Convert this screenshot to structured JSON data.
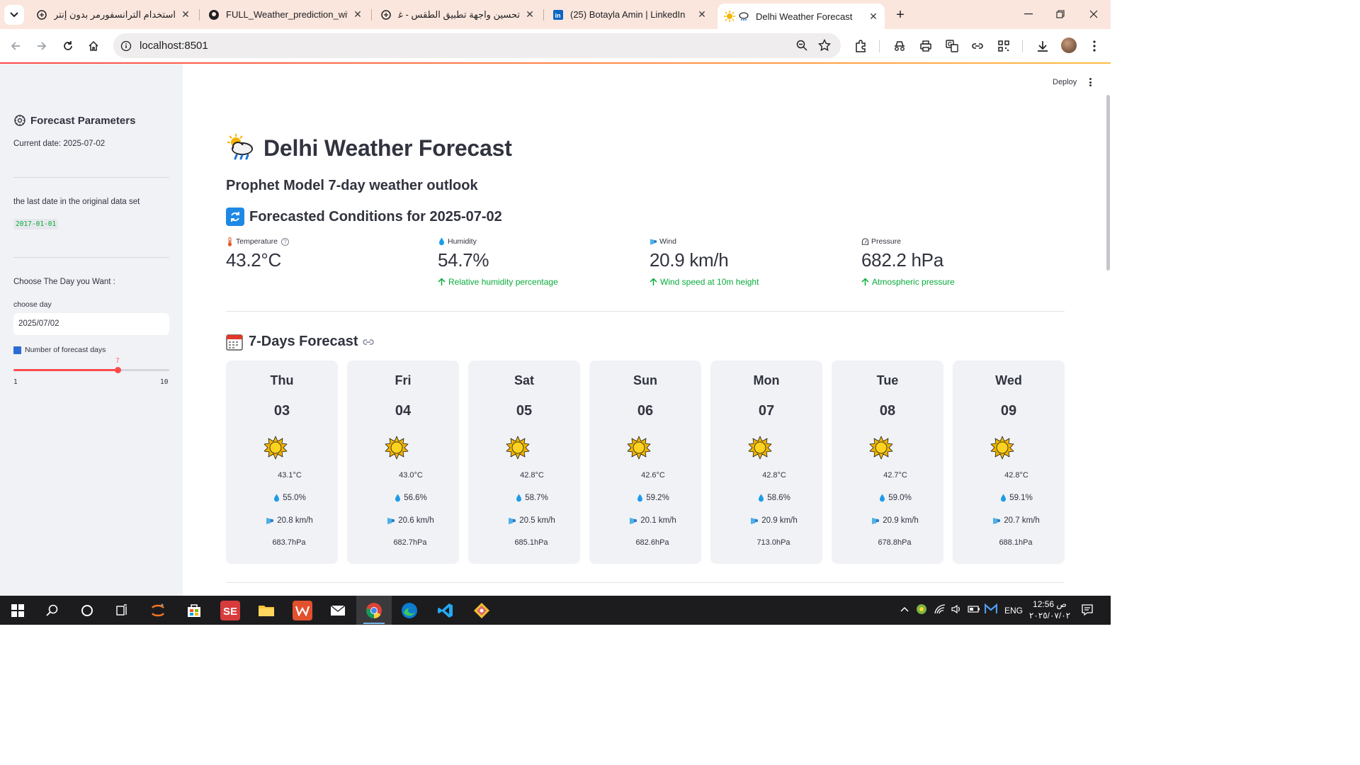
{
  "browser": {
    "tabs": [
      {
        "title": "استخدام الترانسفورمر بدون إنترنت",
        "icon": "openai-icon"
      },
      {
        "title": "FULL_Weather_prediction_with_",
        "icon": "github-icon"
      },
      {
        "title": "تحسين واجهة تطبيق الطقس - غر",
        "icon": "openai-icon"
      },
      {
        "title": "(25) Botayla Amin | LinkedIn",
        "icon": "linkedin-icon"
      },
      {
        "title": "Delhi Weather Forecast",
        "icon": "weather-icon",
        "active": true
      }
    ],
    "url": "localhost:8501"
  },
  "app": {
    "deploy_label": "Deploy",
    "title": "Delhi Weather Forecast",
    "subtitle": "Prophet Model 7-day weather outlook",
    "conditions_header": "Forecasted Conditions for 2025-07-02",
    "forecast_header": "7-Days Forecast"
  },
  "sidebar": {
    "header": "Forecast Parameters",
    "current_date": "Current date: 2025-07-02",
    "last_date_label": "the last date in the original data set",
    "last_date_value": "2017-01-01",
    "choose_prompt": "Choose The Day you Want :",
    "date_input_label": "choose day",
    "date_input_value": "2025/07/02",
    "slider_label": "Number of forecast days",
    "slider_value": 7,
    "slider_min": 1,
    "slider_max": 10
  },
  "metrics": [
    {
      "label": "Temperature",
      "value": "43.2°C",
      "delta": "",
      "icon": "thermometer-icon",
      "help": true
    },
    {
      "label": "Humidity",
      "value": "54.7%",
      "delta": "Relative humidity percentage",
      "icon": "droplet-icon"
    },
    {
      "label": "Wind",
      "value": "20.9 km/h",
      "delta": "Wind speed at 10m height",
      "icon": "wind-icon"
    },
    {
      "label": "Pressure",
      "value": "682.2 hPa",
      "delta": "Atmospheric pressure",
      "icon": "gauge-icon"
    }
  ],
  "forecast": [
    {
      "day": "Thu",
      "date": "03",
      "temp": "43.1°C",
      "humidity": "55.0%",
      "wind": "20.8 km/h",
      "pressure": "683.7hPa"
    },
    {
      "day": "Fri",
      "date": "04",
      "temp": "43.0°C",
      "humidity": "56.6%",
      "wind": "20.6 km/h",
      "pressure": "682.7hPa"
    },
    {
      "day": "Sat",
      "date": "05",
      "temp": "42.8°C",
      "humidity": "58.7%",
      "wind": "20.5 km/h",
      "pressure": "685.1hPa"
    },
    {
      "day": "Sun",
      "date": "06",
      "temp": "42.6°C",
      "humidity": "59.2%",
      "wind": "20.1 km/h",
      "pressure": "682.6hPa"
    },
    {
      "day": "Mon",
      "date": "07",
      "temp": "42.8°C",
      "humidity": "58.6%",
      "wind": "20.9 km/h",
      "pressure": "713.0hPa"
    },
    {
      "day": "Tue",
      "date": "08",
      "temp": "42.7°C",
      "humidity": "59.0%",
      "wind": "20.9 km/h",
      "pressure": "678.8hPa"
    },
    {
      "day": "Wed",
      "date": "09",
      "temp": "42.8°C",
      "humidity": "59.1%",
      "wind": "20.7 km/h",
      "pressure": "688.1hPa"
    }
  ],
  "taskbar": {
    "lang": "ENG",
    "time": "12:56 ص",
    "date": "٢٠٢٥/٠٧/٠٢"
  },
  "colors": {
    "accent": "#ff4b4b",
    "delta_green": "#09ab3b",
    "sidebar_bg": "#f0f2f6",
    "text": "#31333f"
  }
}
